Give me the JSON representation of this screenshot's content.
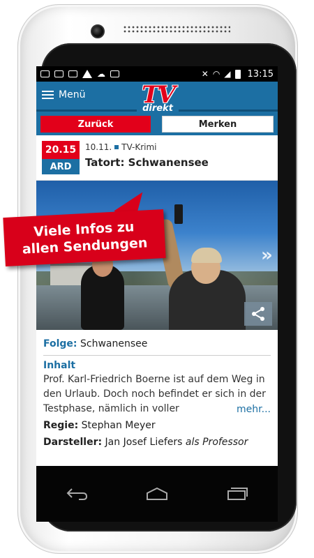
{
  "status_bar": {
    "time": "13:15",
    "icons_left": [
      "image-icon",
      "mail-icon",
      "photo-icon",
      "warning-icon",
      "cloud-upload-icon",
      "briefcase-icon"
    ],
    "icons_right": [
      "mute-icon",
      "wifi-icon",
      "signal-icon",
      "battery-icon"
    ]
  },
  "app_bar": {
    "menu_label": "Menü",
    "logo_primary": "TV",
    "logo_secondary": "direkt"
  },
  "actions": {
    "back_label": "Zurück",
    "save_label": "Merken"
  },
  "program": {
    "time": "20.15",
    "channel": "ARD",
    "date": "10.11.",
    "genre": "TV-Krimi",
    "title": "Tatort: Schwanensee"
  },
  "hero": {
    "prev_arrow": "«",
    "next_arrow": "»",
    "share_icon": "share-icon"
  },
  "details": {
    "episode_label": "Folge:",
    "episode_value": "Schwanensee",
    "content_title": "Inhalt",
    "content_text": "Prof. Karl-Friedrich Boerne ist auf dem Weg in den Urlaub. Doch noch befindet er sich in der Testphase, nämlich in voller",
    "more_link": "mehr...",
    "director_label": "Regie:",
    "director_value": "Stephan Meyer",
    "cast_label": "Darsteller:",
    "cast_value": "Jan Josef Liefers",
    "cast_role": "als Professor"
  },
  "callout": {
    "line1": "Viele Infos zu",
    "line2": "allen Sendungen"
  },
  "colors": {
    "accent_blue": "#1c6fa3",
    "accent_red": "#e2001a"
  }
}
